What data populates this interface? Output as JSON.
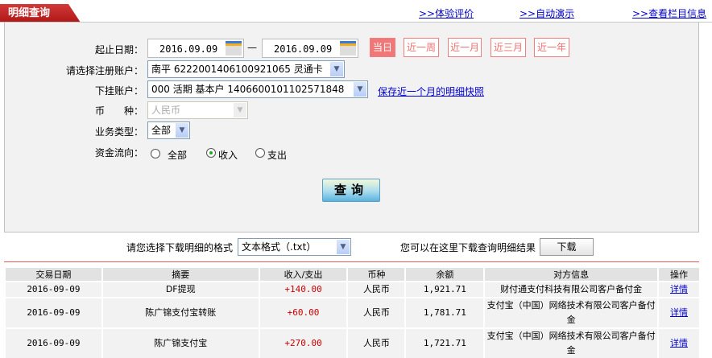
{
  "header": {
    "tab": "明细查询",
    "links": [
      ">>体验评价",
      ">>自动演示",
      ">>查看栏目信息"
    ]
  },
  "form": {
    "date_label": "起止日期：",
    "start_date": "2016.09.09",
    "end_date": "2016.09.09",
    "dash": "—",
    "quick_ranges": [
      "当日",
      "近一周",
      "近一月",
      "近三月",
      "近一年"
    ],
    "quick_selected": "当日",
    "account_label": "请选择注册账户：",
    "account_value": "南平  6222001406100921065  灵通卡",
    "sub_account_label": "下挂账户：",
    "sub_account_value": "000  活期  基本户  1406600101102571848",
    "snapshot_link": "保存近一个月的明细快照",
    "currency_label": "币　　种：",
    "currency_value": "人民币",
    "type_label": "业务类型：",
    "type_value": "全部",
    "flow_label": "资金流向：",
    "flow_options": [
      "全部",
      "收入",
      "支出"
    ],
    "flow_selected": "收入",
    "query_button": "查询"
  },
  "download": {
    "format_label": "请您选择下载明细的格式",
    "format_value": "文本格式（.txt）",
    "hint": "您可以在这里下载查询明细结果",
    "button": "下载"
  },
  "table": {
    "columns": [
      "交易日期",
      "摘要",
      "收入/支出",
      "币种",
      "余额",
      "对方信息",
      "操作"
    ],
    "rows": [
      {
        "date": "2016-09-09",
        "summary": "DF提现",
        "amount": "+140.00",
        "currency": "人民币",
        "balance": "1,921.71",
        "counterparty": "财付通支付科技有限公司客户备付金",
        "action": "详情"
      },
      {
        "date": "2016-09-09",
        "summary": "陈广锦支付宝转账",
        "amount": "+60.00",
        "currency": "人民币",
        "balance": "1,781.71",
        "counterparty": "支付宝（中国）网络技术有限公司客户备付金",
        "action": "详情"
      },
      {
        "date": "2016-09-09",
        "summary": "陈广锦支付宝",
        "amount": "+270.00",
        "currency": "人民币",
        "balance": "1,721.71",
        "counterparty": "支付宝（中国）网络技术有限公司客户备付金",
        "action": "详情"
      }
    ]
  },
  "colors": {
    "accent": "#c02020",
    "link": "#0000cc",
    "amount": "#cc0000"
  }
}
